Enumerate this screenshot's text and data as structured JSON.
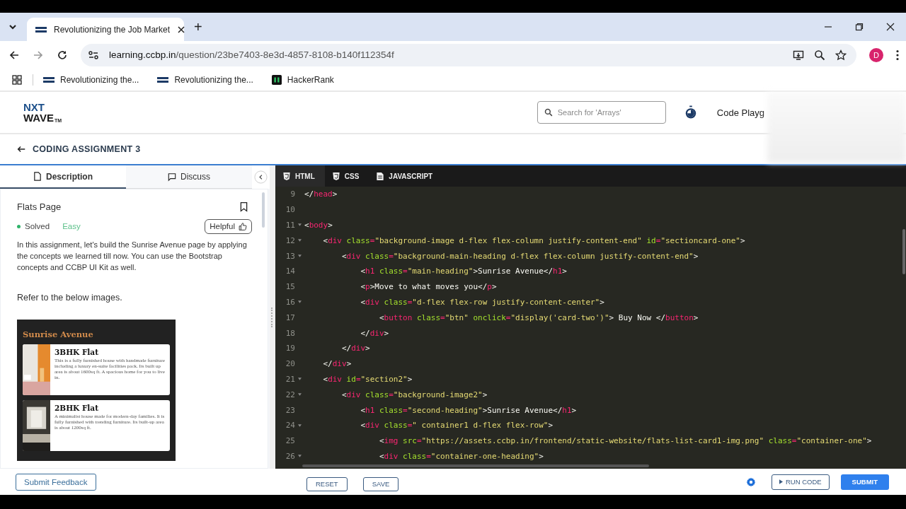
{
  "browser": {
    "tabs": [
      {
        "title": "Revolutionizing the Job Market",
        "selected": true
      }
    ],
    "new_tab": "+",
    "address": {
      "host": "learning.ccbp.in",
      "path": "/question/23be7403-8e3d-4857-8108-b140f112354f"
    },
    "avatar": "D",
    "bookmarks": [
      {
        "label": "Revolutionizing the..."
      },
      {
        "label": "Revolutionizing the..."
      },
      {
        "label": "HackerRank"
      }
    ]
  },
  "header": {
    "logo_top": "NXT",
    "logo_bottom": "WAVE",
    "logo_mark": "TM",
    "search": {
      "placeholder": "Search for 'Arrays'"
    },
    "nav_link": "Code Playg"
  },
  "assignment": {
    "title": "CODING ASSIGNMENT 3"
  },
  "panel": {
    "tabs": [
      {
        "label": "Description",
        "selected": true
      },
      {
        "label": "Discuss",
        "selected": false
      }
    ],
    "problem": {
      "title": "Flats Page",
      "status": "Solved",
      "difficulty": "Easy",
      "helpful": "Helpful",
      "description": "In this assignment, let's build the Sunrise Avenue page by applying the concepts we learned till now. You can use the Bootstrap concepts and CCBP UI Kit as well.",
      "refer": "Refer to the below images."
    },
    "preview": {
      "heading": "Sunrise Avenue",
      "cards": [
        {
          "title": "3BHK Flat",
          "text": "This is a fully furnished house with handmade furniture including a luxury en-suite facilities pack. Its built up area is about 1600sq ft. A spacious home for you to live in."
        },
        {
          "title": "2BHK Flat",
          "text": "A minimalist house made for modern-day families. It is fully furnished with trending furniture. Its built-up area is about 1200sq ft."
        }
      ]
    },
    "feedback": "Submit Feedback"
  },
  "editor": {
    "tabs": [
      {
        "label": "HTML",
        "selected": true
      },
      {
        "label": "CSS",
        "selected": false
      },
      {
        "label": "JAVASCRIPT",
        "selected": false
      }
    ],
    "lines": [
      {
        "number": "9",
        "fold": false,
        "tokens": [
          {
            "kind": "punct",
            "text": "</"
          },
          {
            "kind": "tag",
            "text": "head"
          },
          {
            "kind": "punct",
            "text": ">"
          }
        ]
      },
      {
        "number": "10",
        "fold": false
      },
      {
        "number": "11",
        "fold": true,
        "tokens": [
          {
            "kind": "punct",
            "text": "<"
          },
          {
            "kind": "tag",
            "text": "body"
          },
          {
            "kind": "punct",
            "text": ">"
          }
        ]
      },
      {
        "number": "12",
        "fold": true,
        "tokens": [
          {
            "kind": "punct",
            "text": "    <"
          },
          {
            "kind": "tag",
            "text": "div"
          },
          {
            "kind": "attr",
            "text": " class"
          },
          {
            "kind": "equals",
            "text": "="
          },
          {
            "kind": "string",
            "text": "\"background-image d-flex flex-column justify-content-end\""
          },
          {
            "kind": "attr",
            "text": " id"
          },
          {
            "kind": "equals",
            "text": "="
          },
          {
            "kind": "string",
            "text": "\"sectioncard-one\""
          },
          {
            "kind": "punct",
            "text": ">"
          }
        ]
      },
      {
        "number": "13",
        "fold": true,
        "tokens": [
          {
            "kind": "punct",
            "text": "        <"
          },
          {
            "kind": "tag",
            "text": "div"
          },
          {
            "kind": "attr",
            "text": " class"
          },
          {
            "kind": "equals",
            "text": "="
          },
          {
            "kind": "string",
            "text": "\"background-main-heading d-flex flex-column justify-content-end\""
          },
          {
            "kind": "punct",
            "text": ">"
          }
        ]
      },
      {
        "number": "14",
        "fold": false,
        "tokens": [
          {
            "kind": "punct",
            "text": "            <"
          },
          {
            "kind": "tag",
            "text": "h1"
          },
          {
            "kind": "attr",
            "text": " class"
          },
          {
            "kind": "equals",
            "text": "="
          },
          {
            "kind": "string",
            "text": "\"main-heading\""
          },
          {
            "kind": "punct",
            "text": ">Sunrise Avenue</"
          },
          {
            "kind": "tag",
            "text": "h1"
          },
          {
            "kind": "punct",
            "text": ">"
          }
        ]
      },
      {
        "number": "15",
        "fold": false,
        "tokens": [
          {
            "kind": "punct",
            "text": "            <"
          },
          {
            "kind": "tag",
            "text": "p"
          },
          {
            "kind": "punct",
            "text": ">Move to what moves you</"
          },
          {
            "kind": "tag",
            "text": "p"
          },
          {
            "kind": "punct",
            "text": ">"
          }
        ]
      },
      {
        "number": "16",
        "fold": true,
        "tokens": [
          {
            "kind": "punct",
            "text": "            <"
          },
          {
            "kind": "tag",
            "text": "div"
          },
          {
            "kind": "attr",
            "text": " class"
          },
          {
            "kind": "equals",
            "text": "="
          },
          {
            "kind": "string",
            "text": "\"d-flex flex-row justify-content-center\""
          },
          {
            "kind": "punct",
            "text": ">"
          }
        ]
      },
      {
        "number": "17",
        "fold": false,
        "tokens": [
          {
            "kind": "punct",
            "text": "                <"
          },
          {
            "kind": "tag",
            "text": "button"
          },
          {
            "kind": "attr",
            "text": " class"
          },
          {
            "kind": "equals",
            "text": "="
          },
          {
            "kind": "string",
            "text": "\"btn\""
          },
          {
            "kind": "attr",
            "text": " onclick"
          },
          {
            "kind": "equals",
            "text": "="
          },
          {
            "kind": "string",
            "text": "\"display('card-two')\""
          },
          {
            "kind": "punct",
            "text": "> Buy Now </"
          },
          {
            "kind": "tag",
            "text": "button"
          },
          {
            "kind": "punct",
            "text": ">"
          }
        ]
      },
      {
        "number": "18",
        "fold": false,
        "tokens": [
          {
            "kind": "punct",
            "text": "            </"
          },
          {
            "kind": "tag",
            "text": "div"
          },
          {
            "kind": "punct",
            "text": ">"
          }
        ]
      },
      {
        "number": "19",
        "fold": false,
        "tokens": [
          {
            "kind": "punct",
            "text": "        </"
          },
          {
            "kind": "tag",
            "text": "div"
          },
          {
            "kind": "punct",
            "text": ">"
          }
        ]
      },
      {
        "number": "20",
        "fold": false,
        "tokens": [
          {
            "kind": "punct",
            "text": "    </"
          },
          {
            "kind": "tag",
            "text": "div"
          },
          {
            "kind": "punct",
            "text": ">"
          }
        ]
      },
      {
        "number": "21",
        "fold": true,
        "tokens": [
          {
            "kind": "punct",
            "text": "    <"
          },
          {
            "kind": "tag",
            "text": "div"
          },
          {
            "kind": "attr",
            "text": " id"
          },
          {
            "kind": "equals",
            "text": "="
          },
          {
            "kind": "string",
            "text": "\"section2\""
          },
          {
            "kind": "punct",
            "text": ">"
          }
        ]
      },
      {
        "number": "22",
        "fold": true,
        "tokens": [
          {
            "kind": "punct",
            "text": "        <"
          },
          {
            "kind": "tag",
            "text": "div"
          },
          {
            "kind": "attr",
            "text": " class"
          },
          {
            "kind": "equals",
            "text": "="
          },
          {
            "kind": "string",
            "text": "\"background-image2\""
          },
          {
            "kind": "punct",
            "text": ">"
          }
        ]
      },
      {
        "number": "23",
        "fold": false,
        "tokens": [
          {
            "kind": "punct",
            "text": "            <"
          },
          {
            "kind": "tag",
            "text": "h1"
          },
          {
            "kind": "attr",
            "text": " class"
          },
          {
            "kind": "equals",
            "text": "="
          },
          {
            "kind": "string",
            "text": "\"second-heading\""
          },
          {
            "kind": "punct",
            "text": ">Sunrise Avenue</"
          },
          {
            "kind": "tag",
            "text": "h1"
          },
          {
            "kind": "punct",
            "text": ">"
          }
        ]
      },
      {
        "number": "24",
        "fold": true,
        "tokens": [
          {
            "kind": "punct",
            "text": "            <"
          },
          {
            "kind": "tag",
            "text": "div"
          },
          {
            "kind": "attr",
            "text": " class"
          },
          {
            "kind": "equals",
            "text": "="
          },
          {
            "kind": "string",
            "text": "\" container1 d-flex flex-row\""
          },
          {
            "kind": "punct",
            "text": ">"
          }
        ]
      },
      {
        "number": "25",
        "fold": false,
        "tokens": [
          {
            "kind": "punct",
            "text": "                <"
          },
          {
            "kind": "tag",
            "text": "img"
          },
          {
            "kind": "attr",
            "text": " src"
          },
          {
            "kind": "equals",
            "text": "="
          },
          {
            "kind": "string",
            "text": "\"https://assets.ccbp.in/frontend/static-website/flats-list-card1-img.png\""
          },
          {
            "kind": "attr",
            "text": " class"
          },
          {
            "kind": "equals",
            "text": "="
          },
          {
            "kind": "string",
            "text": "\"container-one\""
          },
          {
            "kind": "punct",
            "text": ">"
          }
        ]
      },
      {
        "number": "26",
        "fold": true,
        "tokens": [
          {
            "kind": "punct",
            "text": "                <"
          },
          {
            "kind": "tag",
            "text": "div"
          },
          {
            "kind": "attr",
            "text": " class"
          },
          {
            "kind": "equals",
            "text": "="
          },
          {
            "kind": "string",
            "text": "\"container-one-heading\""
          },
          {
            "kind": "punct",
            "text": ">"
          }
        ]
      }
    ]
  },
  "actions": {
    "reset": "RESET",
    "save": "SAVE",
    "run": "RUN CODE",
    "submit": "SUBMIT"
  }
}
